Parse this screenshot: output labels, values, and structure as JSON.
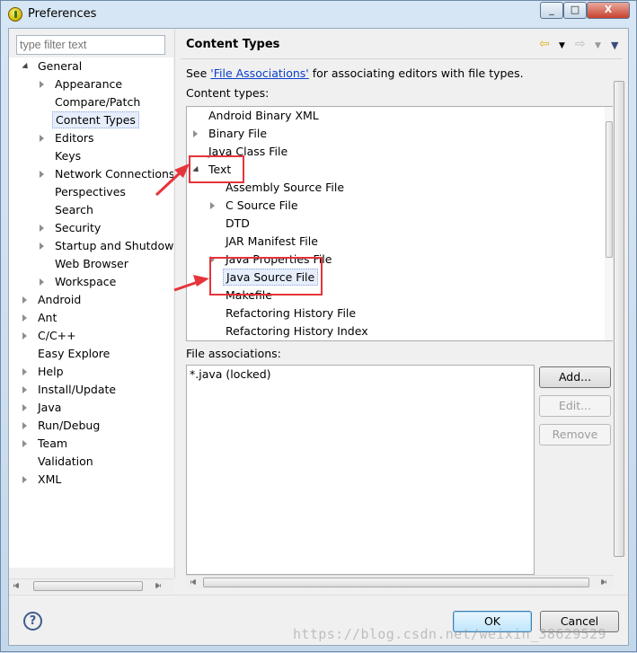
{
  "window": {
    "title": "Preferences",
    "controls": [
      "_",
      "□",
      "X"
    ]
  },
  "left": {
    "filter_placeholder": "type filter text",
    "tree": [
      {
        "label": "General",
        "level": 0,
        "expander": "open"
      },
      {
        "label": "Appearance",
        "level": 1,
        "expander": "closed"
      },
      {
        "label": "Compare/Patch",
        "level": 1,
        "expander": "none"
      },
      {
        "label": "Content Types",
        "level": 1,
        "expander": "none",
        "selected": true
      },
      {
        "label": "Editors",
        "level": 1,
        "expander": "closed"
      },
      {
        "label": "Keys",
        "level": 1,
        "expander": "none"
      },
      {
        "label": "Network Connections",
        "level": 1,
        "expander": "closed"
      },
      {
        "label": "Perspectives",
        "level": 1,
        "expander": "none"
      },
      {
        "label": "Search",
        "level": 1,
        "expander": "none"
      },
      {
        "label": "Security",
        "level": 1,
        "expander": "closed"
      },
      {
        "label": "Startup and Shutdown",
        "level": 1,
        "expander": "closed"
      },
      {
        "label": "Web Browser",
        "level": 1,
        "expander": "none"
      },
      {
        "label": "Workspace",
        "level": 1,
        "expander": "closed"
      },
      {
        "label": "Android",
        "level": 0,
        "expander": "closed"
      },
      {
        "label": "Ant",
        "level": 0,
        "expander": "closed"
      },
      {
        "label": "C/C++",
        "level": 0,
        "expander": "closed"
      },
      {
        "label": "Easy Explore",
        "level": 0,
        "expander": "none"
      },
      {
        "label": "Help",
        "level": 0,
        "expander": "closed"
      },
      {
        "label": "Install/Update",
        "level": 0,
        "expander": "closed"
      },
      {
        "label": "Java",
        "level": 0,
        "expander": "closed"
      },
      {
        "label": "Run/Debug",
        "level": 0,
        "expander": "closed"
      },
      {
        "label": "Team",
        "level": 0,
        "expander": "closed"
      },
      {
        "label": "Validation",
        "level": 0,
        "expander": "none"
      },
      {
        "label": "XML",
        "level": 0,
        "expander": "closed"
      }
    ]
  },
  "page": {
    "title": "Content Types",
    "desc_prefix": "See ",
    "desc_link": "'File Associations'",
    "desc_suffix": " for associating editors with file types.",
    "content_types_label": "Content types:",
    "content_types": [
      {
        "label": "Android Binary XML",
        "level": 0,
        "expander": "none"
      },
      {
        "label": "Binary File",
        "level": 0,
        "expander": "closed"
      },
      {
        "label": "Java Class File",
        "level": 0,
        "expander": "none"
      },
      {
        "label": "Text",
        "level": 0,
        "expander": "open"
      },
      {
        "label": "Assembly Source File",
        "level": 1,
        "expander": "none"
      },
      {
        "label": "C Source File",
        "level": 1,
        "expander": "closed"
      },
      {
        "label": "DTD",
        "level": 1,
        "expander": "none"
      },
      {
        "label": "JAR Manifest File",
        "level": 1,
        "expander": "none"
      },
      {
        "label": "Java Properties File",
        "level": 1,
        "expander": "closed"
      },
      {
        "label": "Java Source File",
        "level": 1,
        "expander": "none",
        "selected": true
      },
      {
        "label": "Makefile",
        "level": 1,
        "expander": "none"
      },
      {
        "label": "Refactoring History File",
        "level": 1,
        "expander": "none"
      },
      {
        "label": "Refactoring History Index",
        "level": 1,
        "expander": "none"
      }
    ],
    "file_assoc_label": "File associations:",
    "file_assoc": [
      "*.java (locked)"
    ],
    "buttons": {
      "add": "Add...",
      "edit": "Edit...",
      "remove": "Remove"
    }
  },
  "footer": {
    "help": "?",
    "ok": "OK",
    "cancel": "Cancel"
  },
  "watermark": "https://blog.csdn.net/weixin_38629529",
  "annotation_color": "#e5343a"
}
